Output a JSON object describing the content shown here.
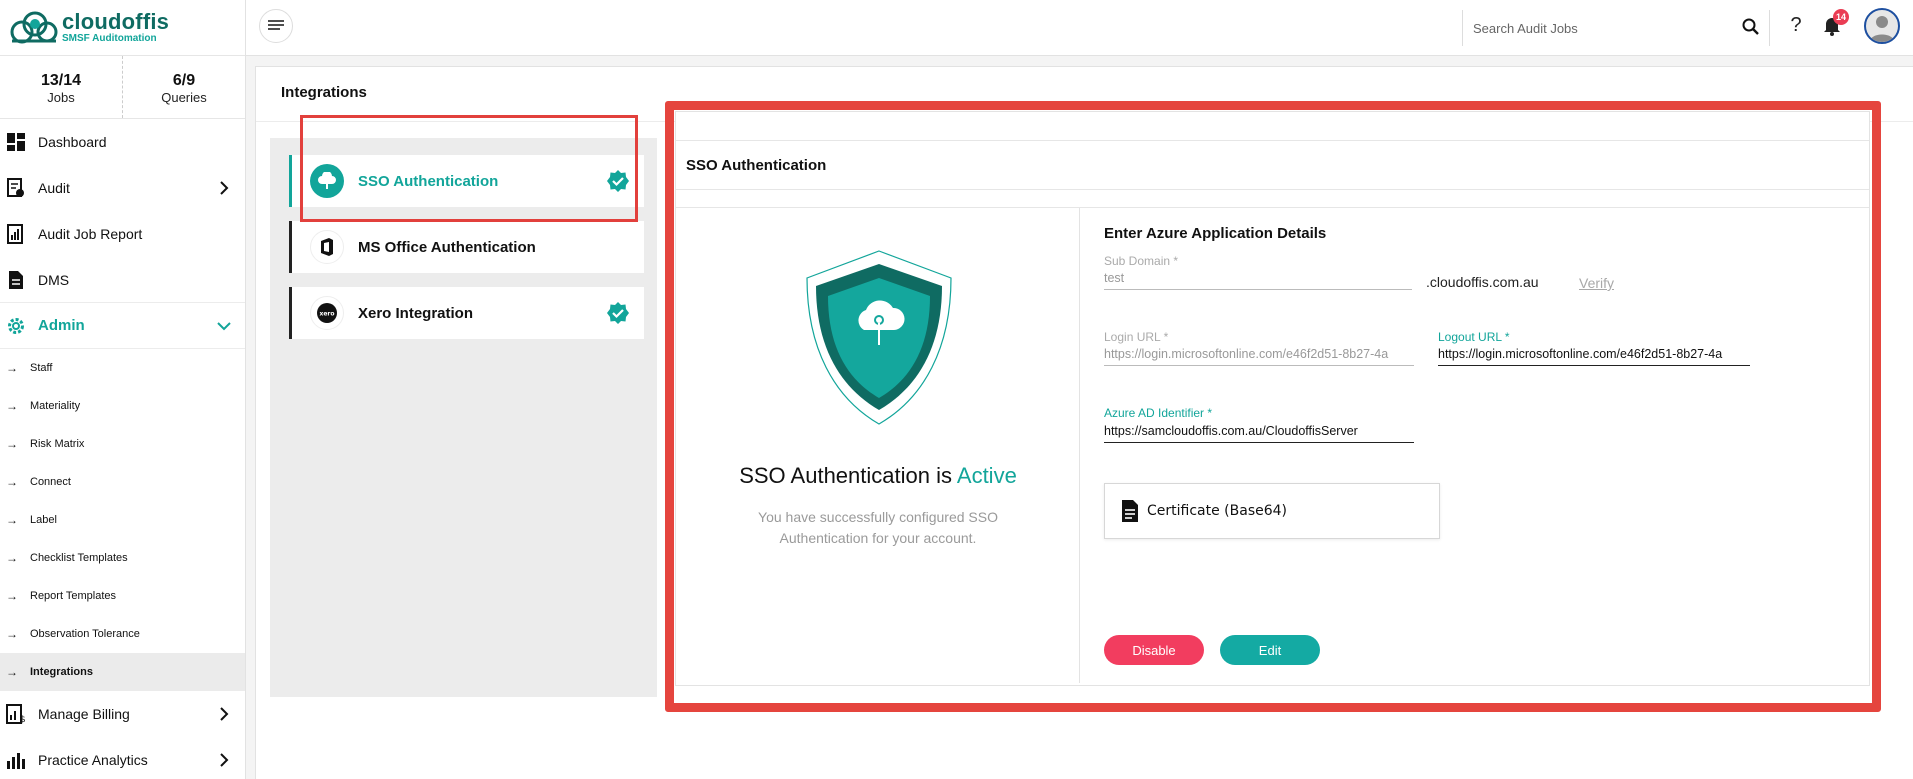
{
  "brand": {
    "name": "cloudoffis",
    "tagline": "SMSF Auditomation",
    "accent": "#12a59a",
    "dark": "#0f6b62"
  },
  "stats": [
    {
      "value": "13/14",
      "label": "Jobs"
    },
    {
      "value": "6/9",
      "label": "Queries"
    }
  ],
  "nav": {
    "dashboard": "Dashboard",
    "audit": "Audit",
    "audit_job_report": "Audit Job Report",
    "dms": "DMS",
    "admin": "Admin",
    "admin_children": [
      "Staff",
      "Materiality",
      "Risk Matrix",
      "Connect",
      "Label",
      "Checklist Templates",
      "Report Templates",
      "Observation Tolerance",
      "Integrations"
    ],
    "selected_child": "Integrations",
    "manage_billing": "Manage Billing",
    "practice_analytics": "Practice Analytics"
  },
  "header": {
    "search_placeholder": "Search Audit Jobs",
    "help": "?",
    "notification_count": "14"
  },
  "page": {
    "title": "Integrations"
  },
  "integrations": [
    {
      "label": "SSO Authentication",
      "active": true,
      "connected": true,
      "icon": "cloud-key-icon"
    },
    {
      "label": "MS Office Authentication",
      "active": false,
      "connected": false,
      "icon": "office-icon"
    },
    {
      "label": "Xero Integration",
      "active": false,
      "connected": true,
      "icon": "xero-icon"
    }
  ],
  "sso": {
    "panel_title": "SSO Authentication",
    "status_prefix": "SSO Authentication is",
    "status_word": "Active",
    "status_desc": "You have successfully configured SSO Authentication for your account.",
    "form_title": "Enter Azure Application Details",
    "subdomain_label": "Sub Domain *",
    "subdomain_value": "test",
    "subdomain_suffix": ".cloudoffis.com.au",
    "verify": "Verify",
    "login_url_label": "Login URL *",
    "login_url_value": "https://login.microsoftonline.com/e46f2d51-8b27-4a",
    "logout_url_label": "Logout URL *",
    "logout_url_value": "https://login.microsoftonline.com/e46f2d51-8b27-4a",
    "azure_ad_label": "Azure AD Identifier *",
    "azure_ad_prefix": "https://samcloudoffis.com.au",
    "azure_ad_value": "/CloudoffisServer",
    "certificate": "Certificate (Base64)",
    "disable": "Disable",
    "edit": "Edit"
  }
}
